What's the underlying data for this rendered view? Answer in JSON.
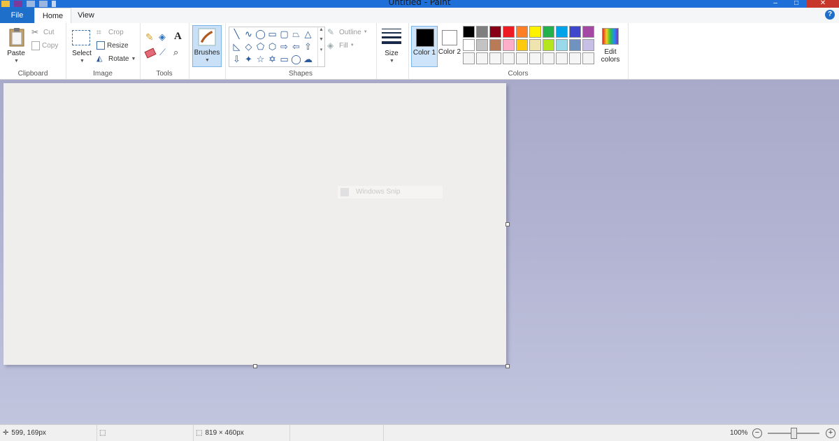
{
  "app": {
    "title": "Untitled - Paint"
  },
  "tabs": {
    "file": "File",
    "home": "Home",
    "view": "View",
    "help": "?"
  },
  "ribbon": {
    "clipboard": {
      "label": "Clipboard",
      "paste": "Paste",
      "cut": "Cut",
      "copy": "Copy"
    },
    "image": {
      "label": "Image",
      "select": "Select",
      "crop": "Crop",
      "resize": "Resize",
      "rotate": "Rotate"
    },
    "tools": {
      "label": "Tools",
      "text_glyph": "A"
    },
    "brushes": {
      "label": "Brushes"
    },
    "shapes": {
      "label": "Shapes",
      "outline": "Outline",
      "fill": "Fill"
    },
    "size": {
      "label": "Size"
    },
    "colors": {
      "label": "Colors",
      "color1": "Color 1",
      "color2": "Color 2",
      "edit": "Edit colors",
      "color1_value": "#000000",
      "color2_value": "#ffffff",
      "palette": [
        "#000000",
        "#7f7f7f",
        "#880015",
        "#ed1c24",
        "#ff7f27",
        "#fff200",
        "#22b14c",
        "#00a2e8",
        "#3f48cc",
        "#a349a4",
        "#ffffff",
        "#c3c3c3",
        "#b97a57",
        "#ffaec9",
        "#ffc90e",
        "#efe4b0",
        "#b5e61d",
        "#99d9ea",
        "#7092be",
        "#c8bfe7",
        "#f5f5f5",
        "#f5f5f5",
        "#f5f5f5",
        "#f5f5f5",
        "#f5f5f5",
        "#f5f5f5",
        "#f5f5f5",
        "#f5f5f5",
        "#f5f5f5",
        "#f5f5f5"
      ]
    }
  },
  "canvas": {
    "ghost_text": "Windows Snip"
  },
  "status": {
    "cursor_pos": "599, 169px",
    "selection_size": "",
    "image_size": "819 × 460px",
    "zoom": "100%",
    "zoom_out": "−",
    "zoom_in": "+"
  },
  "colors": {
    "accent": "#1e6fc9",
    "workspace": "#b2b3d2"
  }
}
